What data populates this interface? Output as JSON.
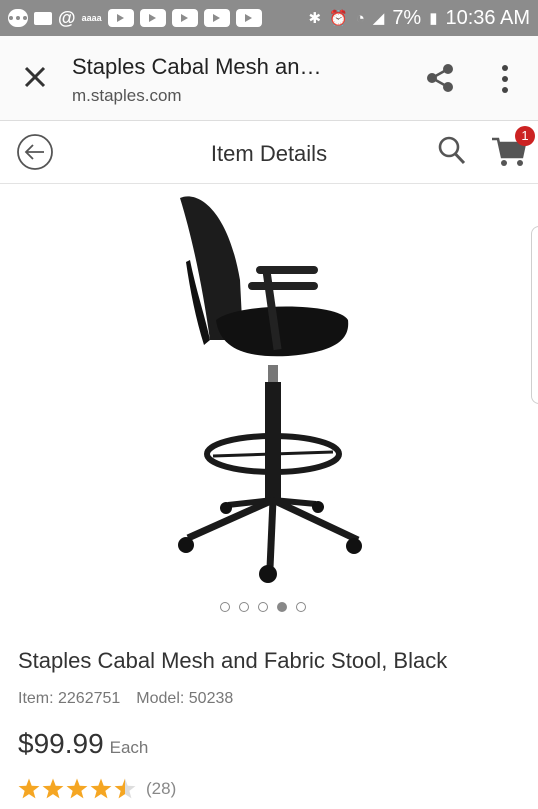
{
  "status_bar": {
    "battery": "7%",
    "time": "10:36 AM",
    "app_badge": "aaaa"
  },
  "browser": {
    "page_title": "Staples Cabal Mesh an…",
    "url": "m.staples.com"
  },
  "header": {
    "title": "Item Details",
    "cart_count": "1"
  },
  "product": {
    "name": "Staples Cabal Mesh and Fabric Stool, Black",
    "item_label": "Item: 2262751",
    "model_label": "Model: 50238",
    "price": "$99.99",
    "price_unit": "Each",
    "rating": 4.5,
    "review_count": "(28)",
    "image_index": 4,
    "image_count": 5
  },
  "colors": {
    "status_bar": "#8c8c8c",
    "star": "#f5a623",
    "badge": "#cc2222"
  }
}
